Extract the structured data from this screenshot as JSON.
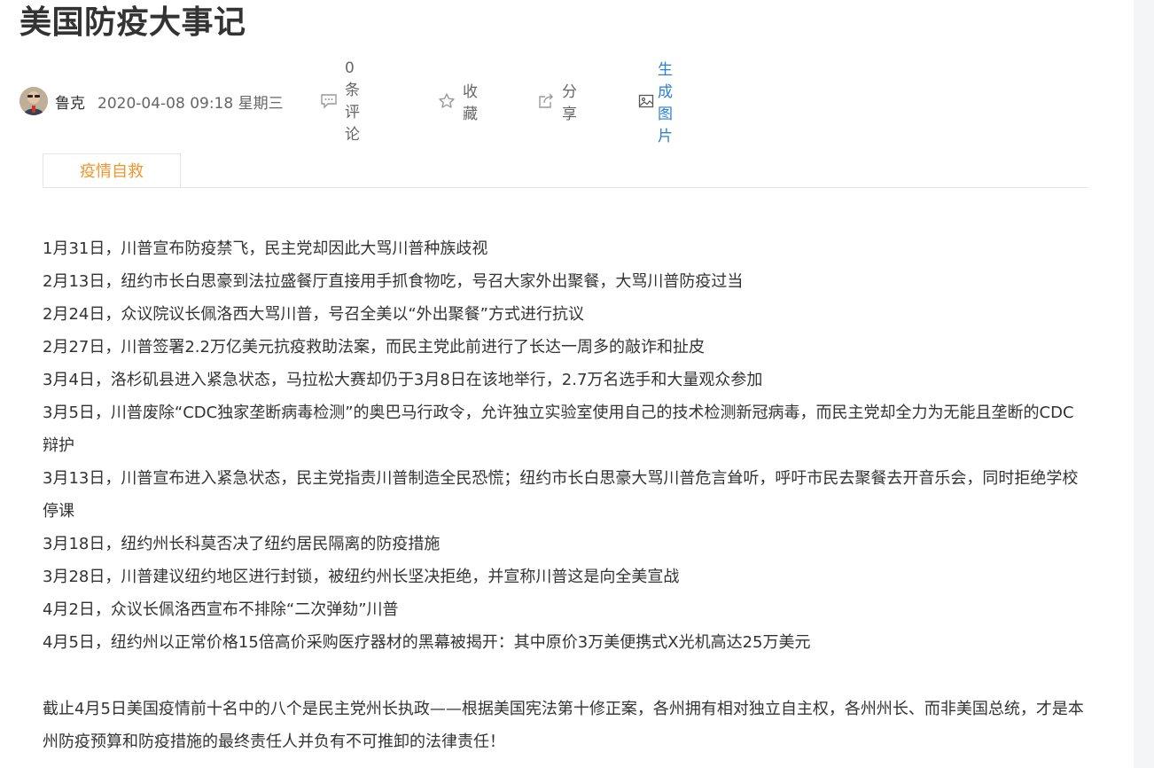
{
  "article": {
    "title": "美国防疫大事记",
    "author": "鲁克",
    "datetime": "2020-04-08 09:18 星期三",
    "comments_label": "0条评论",
    "favorite_label": "收藏",
    "share_label": "分享",
    "generate_image_label": "生成图片",
    "accent_color": "#f0962e",
    "link_color": "#2b7fd6"
  },
  "tabs": [
    {
      "label": "疫情自救",
      "active": true
    }
  ],
  "events": [
    "1月31日，川普宣布防疫禁飞，民主党却因此大骂川普种族歧视",
    "2月13日，纽约市长白思豪到法拉盛餐厅直接用手抓食物吃，号召大家外出聚餐，大骂川普防疫过当",
    "2月24日，众议院议长佩洛西大骂川普，号召全美以“外出聚餐”方式进行抗议",
    "2月27日，川普签署2.2万亿美元抗疫救助法案，而民主党此前进行了长达一周多的敲诈和扯皮",
    "3月4日，洛杉矶县进入紧急状态，马拉松大赛却仍于3月8日在该地举行，2.7万名选手和大量观众参加",
    "3月5日，川普废除“CDC独家垄断病毒检测”的奥巴马行政令，允许独立实验室使用自己的技术检测新冠病毒，而民主党却全力为无能且垄断的CDC辩护",
    "3月13日，川普宣布进入紧急状态，民主党指责川普制造全民恐慌；纽约市长白思豪大骂川普危言耸听，呼吁市民去聚餐去开音乐会，同时拒绝学校停课",
    "3月18日，纽约州长科莫否决了纽约居民隔离的防疫措施",
    "3月28日，川普建议纽约地区进行封锁，被纽约州长坚决拒绝，并宣称川普这是向全美宣战",
    "4月2日，众议长佩洛西宣布不排除“二次弹劾”川普",
    "4月5日，纽约州以正常价格15倍高价采购医疗器材的黑幕被揭开：其中原价3万美便携式X光机高达25万美元"
  ],
  "summary": "截止4月5日美国疫情前十名中的八个是民主党州长执政——根据美国宪法第十修正案，各州拥有相对独立自主权，各州州长、而非美国总统，才是本州防疫预算和防疫措施的最终责任人并负有不可推卸的法律责任！"
}
